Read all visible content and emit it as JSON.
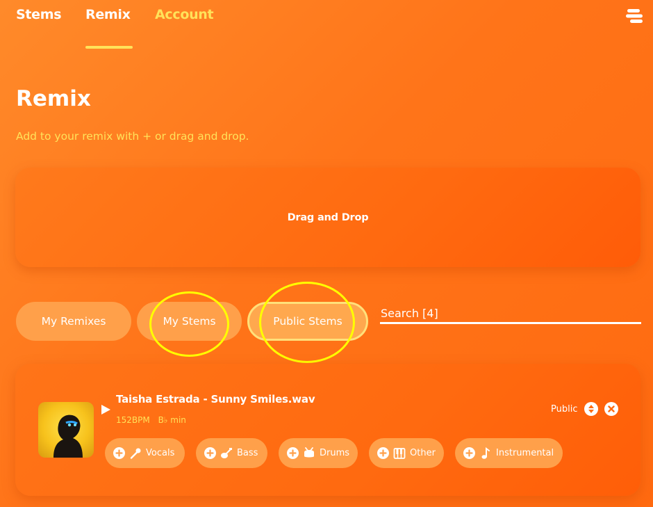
{
  "nav": {
    "stems": "Stems",
    "remix": "Remix",
    "account": "Account",
    "menu_icon": "menu-icon"
  },
  "page": {
    "title": "Remix",
    "subtitle": "Add to your remix with + or drag and drop."
  },
  "dropzone": {
    "label": "Drag and Drop"
  },
  "tabs": [
    {
      "label": "My Remixes"
    },
    {
      "label": "My Stems"
    },
    {
      "label": "Public Stems",
      "active": true
    }
  ],
  "search": {
    "placeholder": "Search [4]",
    "value": ""
  },
  "track": {
    "title": "Taisha Estrada - Sunny Smiles.wav",
    "bpm": "152BPM",
    "key": "B♭ min",
    "visibility": "Public",
    "stems": [
      {
        "label": "Vocals",
        "icon": "microphone-icon"
      },
      {
        "label": "Bass",
        "icon": "guitar-icon"
      },
      {
        "label": "Drums",
        "icon": "drum-icon"
      },
      {
        "label": "Other",
        "icon": "piano-icon"
      },
      {
        "label": "Instrumental",
        "icon": "music-note-icon"
      }
    ]
  },
  "colors": {
    "accent": "#ffe25a",
    "background": "#ff7419",
    "pill": "#ffa04a",
    "annotation": "#ffff00"
  }
}
